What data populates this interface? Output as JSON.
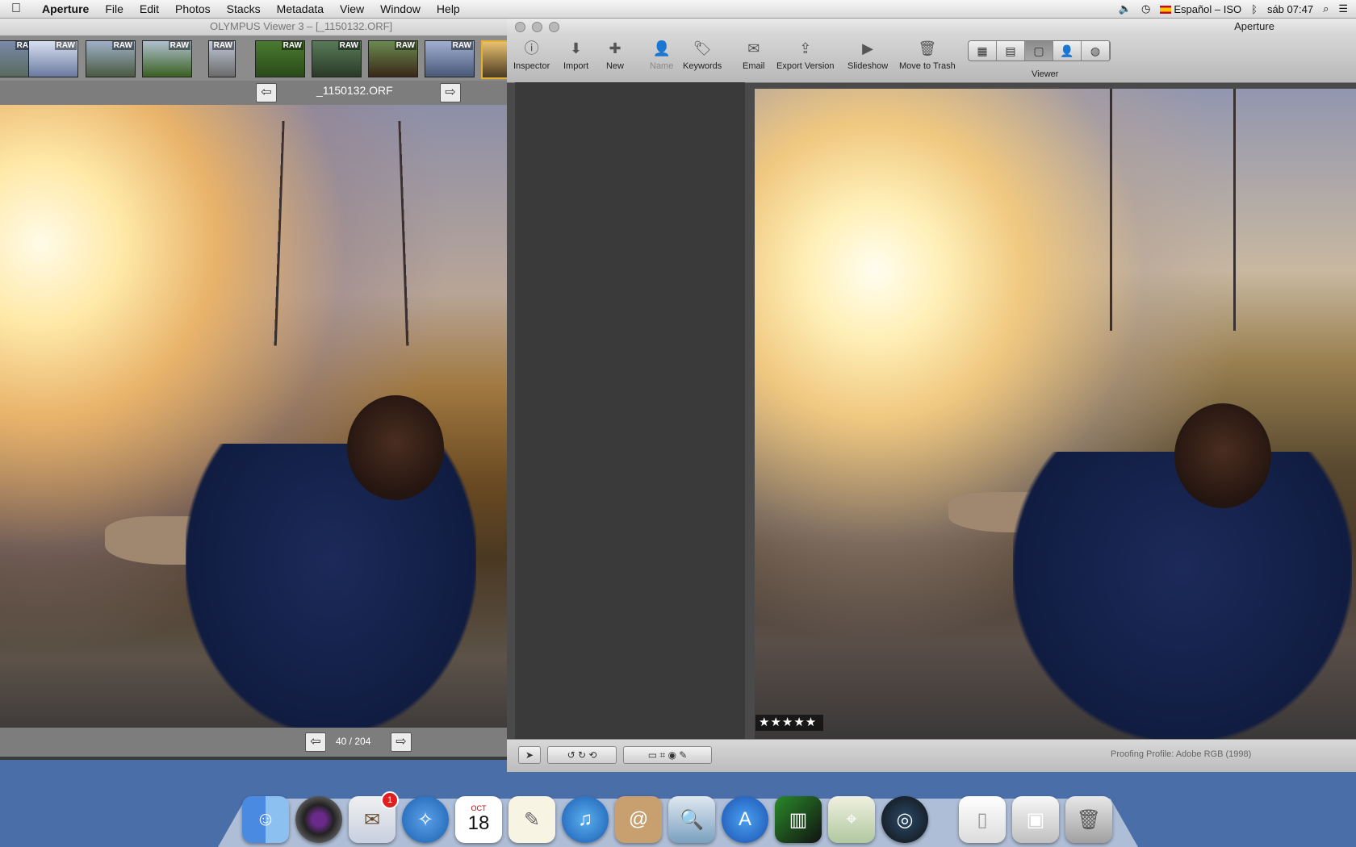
{
  "menubar": {
    "apple": "",
    "app": "Aperture",
    "items": [
      "File",
      "Edit",
      "Photos",
      "Stacks",
      "Metadata",
      "View",
      "Window",
      "Help"
    ],
    "input_source": "Español – ISO",
    "clock": "sáb 07:47"
  },
  "olympus": {
    "title": "OLYMPUS Viewer 3 – [_1150132.ORF]",
    "filename": "_1150132.ORF",
    "raw_label": "RAW",
    "counter": "40 / 204",
    "prev": "⇦",
    "next": "⇨"
  },
  "aperture": {
    "title": "Aperture",
    "toolbar": {
      "inspector": "Inspector",
      "import": "Import",
      "new": "New",
      "name": "Name",
      "keywords": "Keywords",
      "email": "Email",
      "export": "Export Version",
      "slideshow": "Slideshow",
      "trash": "Move to Trash",
      "viewer": "Viewer"
    },
    "rating": "★★★★★",
    "proofing": "Proofing Profile: Adobe RGB (1998)"
  },
  "dock": {
    "calendar_month": "OCT",
    "calendar_day": "18",
    "mail_badge": "1"
  }
}
